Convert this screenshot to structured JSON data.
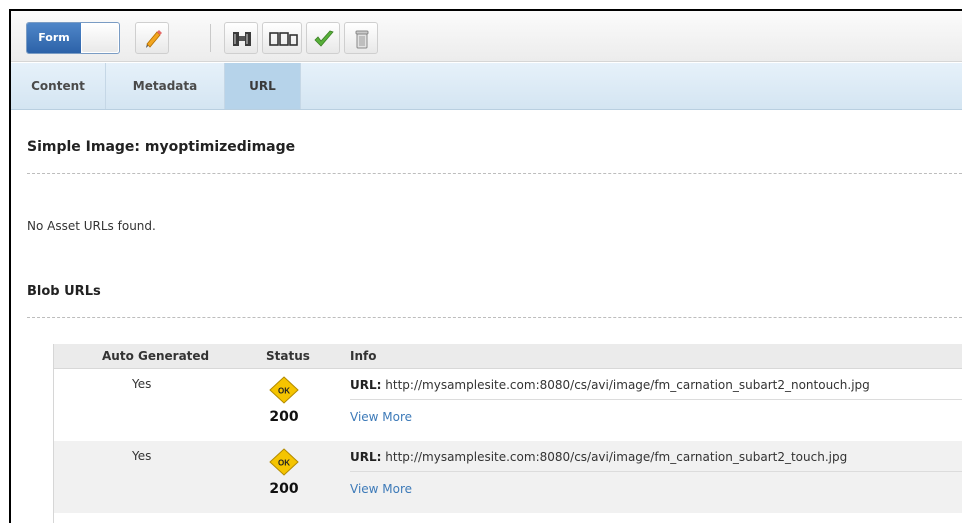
{
  "toolbar": {
    "form_toggle_label": "Form",
    "buttons": [
      {
        "name": "edit-button",
        "icon": "pencil-icon"
      },
      {
        "name": "inspect-button",
        "icon": "binoculars-icon"
      },
      {
        "name": "preview-button",
        "icon": "preview-panels-icon"
      },
      {
        "name": "approve-button",
        "icon": "checkmark-icon"
      },
      {
        "name": "delete-button",
        "icon": "trash-icon"
      }
    ]
  },
  "tabs": [
    {
      "label": "Content",
      "active": false
    },
    {
      "label": "Metadata",
      "active": false
    },
    {
      "label": "URL",
      "active": true
    }
  ],
  "page": {
    "title": "Simple Image: myoptimizedimage",
    "no_asset_urls": "No Asset URLs found.",
    "blob_section_title": "Blob URLs"
  },
  "table": {
    "headers": [
      "Auto Generated",
      "Status",
      "Info"
    ],
    "rows": [
      {
        "auto_generated": "Yes",
        "status_badge": "OK",
        "status_code": "200",
        "url_label": "URL:",
        "url": "http://mysamplesite.com:8080/cs/avi/image/fm_carnation_subart2_nontouch.jpg",
        "view_more": "View More"
      },
      {
        "auto_generated": "Yes",
        "status_badge": "OK",
        "status_code": "200",
        "url_label": "URL:",
        "url": "http://mysamplesite.com:8080/cs/avi/image/fm_carnation_subart2_touch.jpg",
        "view_more": "View More"
      }
    ]
  },
  "colors": {
    "toggle_blue": "#2c62a8",
    "tab_active": "#b6d3ea",
    "ok_badge": "#f5c400",
    "link": "#3d7ab8"
  }
}
